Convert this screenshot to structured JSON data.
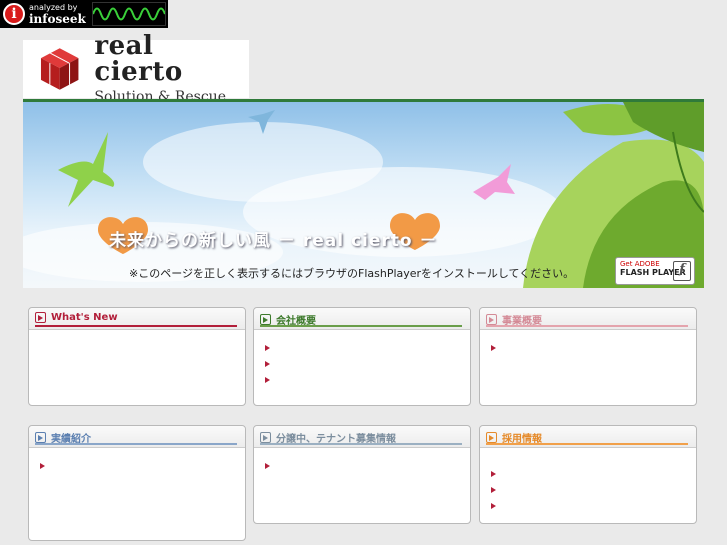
{
  "badge": {
    "icon": "info-i-icon",
    "small_text": "analyzed by",
    "brand_text": "infoseek"
  },
  "logo": {
    "brand": "real cierto",
    "tagline": "Solution & Rescue",
    "icon": "red-cube-icon"
  },
  "banner": {
    "headline": "未来からの新しい風 － real cierto －",
    "notice": "※このページを正しく表示するにはブラウザのFlashPlayerをインストールしてください。",
    "flash_button": {
      "get": "Get ADOBE",
      "player": "FLASH PLAYER",
      "icon": "flash-f-icon"
    }
  },
  "colors": {
    "accent_green": "#2f7a3a",
    "red": "#b21f3a",
    "green": "#3d7a2c",
    "pink": "#d48a96",
    "blue": "#5b7fb0",
    "grey_blue": "#7c8e9e",
    "orange": "#e58a2a"
  },
  "panels": [
    {
      "title": "What's New",
      "items": 0
    },
    {
      "title": "会社概要",
      "items": 3
    },
    {
      "title": "事業概要",
      "items": 1
    },
    {
      "title": "実績紹介",
      "items": 1
    },
    {
      "title": "分譲中、テナント募集情報",
      "items": 1
    },
    {
      "title": "採用情報",
      "items": 3
    }
  ]
}
